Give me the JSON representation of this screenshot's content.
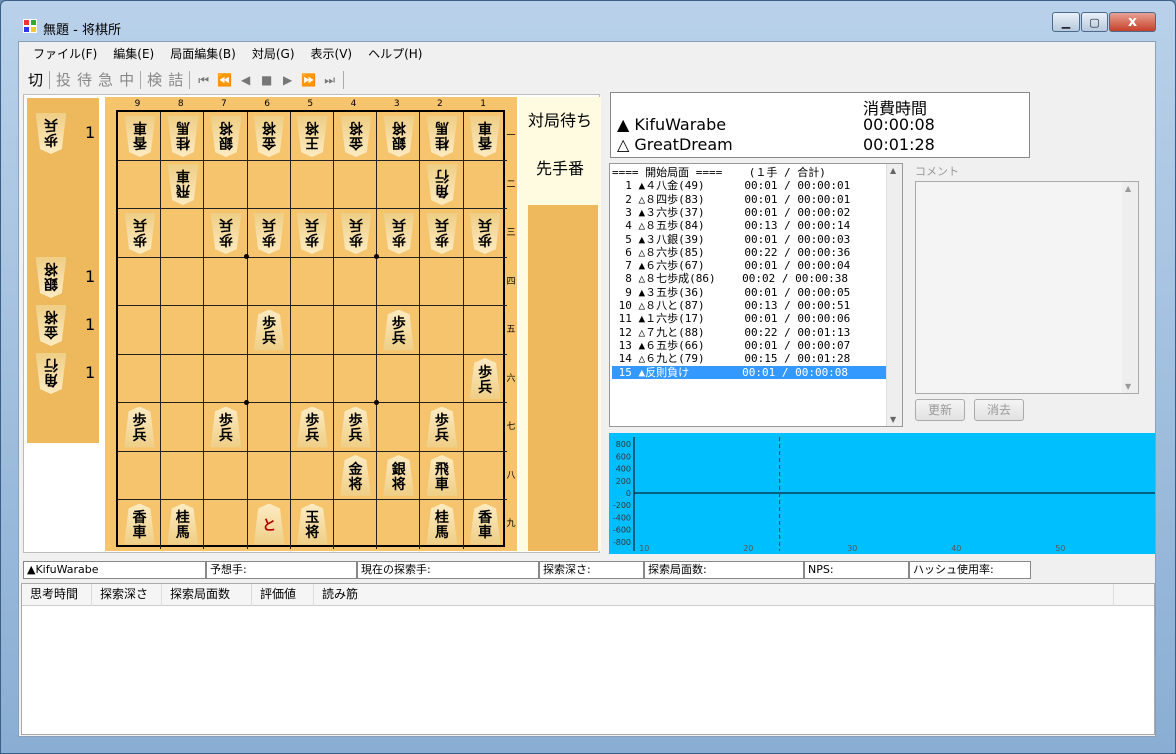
{
  "window": {
    "title": "無題 - 将棋所",
    "min_icon": "minimize-icon",
    "max_icon": "maximize-icon",
    "close_icon": "close-icon",
    "close_glyph": "x",
    "app_icon": "app-icon"
  },
  "menu": [
    {
      "label": "ファイル(F)"
    },
    {
      "label": "編集(E)"
    },
    {
      "label": "局面編集(B)"
    },
    {
      "label": "対局(G)"
    },
    {
      "label": "表示(V)"
    },
    {
      "label": "ヘルプ(H)"
    }
  ],
  "toolbar": {
    "switch_label": "切",
    "resign_label": "投",
    "wait_label": "待",
    "hurry_label": "急",
    "stop_label": "中",
    "review_label": "検",
    "tsume_label": "詰",
    "nav_icons": [
      "first-icon",
      "rewind-icon",
      "back-icon",
      "stop-icon",
      "play-icon",
      "forward-icon",
      "last-icon"
    ]
  },
  "board": {
    "files": [
      "9",
      "8",
      "7",
      "6",
      "5",
      "4",
      "3",
      "2",
      "1"
    ],
    "ranks": [
      "一",
      "二",
      "三",
      "四",
      "五",
      "六",
      "七",
      "八",
      "九"
    ],
    "pieces": [
      {
        "c": 0,
        "r": 0,
        "t": "香車",
        "g": true
      },
      {
        "c": 1,
        "r": 0,
        "t": "桂馬",
        "g": true
      },
      {
        "c": 2,
        "r": 0,
        "t": "銀将",
        "g": true
      },
      {
        "c": 3,
        "r": 0,
        "t": "金将",
        "g": true
      },
      {
        "c": 4,
        "r": 0,
        "t": "王将",
        "g": true
      },
      {
        "c": 5,
        "r": 0,
        "t": "金将",
        "g": true
      },
      {
        "c": 6,
        "r": 0,
        "t": "銀将",
        "g": true
      },
      {
        "c": 7,
        "r": 0,
        "t": "桂馬",
        "g": true
      },
      {
        "c": 8,
        "r": 0,
        "t": "香車",
        "g": true
      },
      {
        "c": 1,
        "r": 1,
        "t": "飛車",
        "g": true
      },
      {
        "c": 7,
        "r": 1,
        "t": "角行",
        "g": true
      },
      {
        "c": 0,
        "r": 2,
        "t": "歩兵",
        "g": true
      },
      {
        "c": 2,
        "r": 2,
        "t": "歩兵",
        "g": true
      },
      {
        "c": 3,
        "r": 2,
        "t": "歩兵",
        "g": true
      },
      {
        "c": 4,
        "r": 2,
        "t": "歩兵",
        "g": true
      },
      {
        "c": 5,
        "r": 2,
        "t": "歩兵",
        "g": true
      },
      {
        "c": 6,
        "r": 2,
        "t": "歩兵",
        "g": true
      },
      {
        "c": 7,
        "r": 2,
        "t": "歩兵",
        "g": true
      },
      {
        "c": 8,
        "r": 2,
        "t": "歩兵",
        "g": true
      },
      {
        "c": 3,
        "r": 4,
        "t": "歩兵",
        "g": false
      },
      {
        "c": 6,
        "r": 4,
        "t": "歩兵",
        "g": false
      },
      {
        "c": 8,
        "r": 5,
        "t": "歩兵",
        "g": false
      },
      {
        "c": 0,
        "r": 6,
        "t": "歩兵",
        "g": false
      },
      {
        "c": 2,
        "r": 6,
        "t": "歩兵",
        "g": false
      },
      {
        "c": 4,
        "r": 6,
        "t": "歩兵",
        "g": false
      },
      {
        "c": 5,
        "r": 6,
        "t": "歩兵",
        "g": false
      },
      {
        "c": 7,
        "r": 6,
        "t": "歩兵",
        "g": false
      },
      {
        "c": 5,
        "r": 7,
        "t": "金将",
        "g": false
      },
      {
        "c": 6,
        "r": 7,
        "t": "銀将",
        "g": false
      },
      {
        "c": 7,
        "r": 7,
        "t": "飛車",
        "g": false
      },
      {
        "c": 0,
        "r": 8,
        "t": "香車",
        "g": false
      },
      {
        "c": 1,
        "r": 8,
        "t": "桂馬",
        "g": false
      },
      {
        "c": 3,
        "r": 8,
        "t": "と",
        "g": false,
        "p": true
      },
      {
        "c": 4,
        "r": 8,
        "t": "玉将",
        "g": false
      },
      {
        "c": 7,
        "r": 8,
        "t": "桂馬",
        "g": false
      },
      {
        "c": 8,
        "r": 8,
        "t": "香車",
        "g": false
      }
    ],
    "gote_hand": [
      {
        "t": "歩兵",
        "n": "1"
      },
      {
        "t": "銀将",
        "n": "1"
      },
      {
        "t": "金将",
        "n": "1"
      },
      {
        "t": "角行",
        "n": "1"
      }
    ]
  },
  "side": {
    "status": "対局待ち",
    "turn": "先手番"
  },
  "time": {
    "header": "消費時間",
    "sente_name": "▲ KifuWarabe",
    "sente_time": "00:00:08",
    "gote_name": "△ GreatDream",
    "gote_time": "00:01:28"
  },
  "kifu": {
    "rows": [
      "==== 開始局面 ====    (１手 / 合計)",
      "  1 ▲４八金(49)      00:01 / 00:00:01",
      "  2 △８四歩(83)      00:01 / 00:00:01",
      "  3 ▲３六歩(37)      00:01 / 00:00:02",
      "  4 △８五歩(84)      00:13 / 00:00:14",
      "  5 ▲３八銀(39)      00:01 / 00:00:03",
      "  6 △８六歩(85)      00:22 / 00:00:36",
      "  7 ▲６六歩(67)      00:01 / 00:00:04",
      "  8 △８七歩成(86)    00:02 / 00:00:38",
      "  9 ▲３五歩(36)      00:01 / 00:00:05",
      " 10 △８八と(87)      00:13 / 00:00:51",
      " 11 ▲１六歩(17)      00:01 / 00:00:06",
      " 12 △７九と(88)      00:22 / 00:01:13",
      " 13 ▲６五歩(66)      00:01 / 00:00:07",
      " 14 △６九と(79)      00:15 / 00:01:28",
      " 15 ▲反則負け        00:01 / 00:00:08"
    ],
    "selected_index": 15
  },
  "comment": {
    "label": "コメント",
    "update_label": "更新",
    "clear_label": "消去"
  },
  "graph": {
    "bg": "#00bfff",
    "y_ticks": [
      "800",
      "600",
      "400",
      "200",
      "0",
      "-200",
      "-400",
      "-600",
      "-800"
    ],
    "x_ticks": [
      "10",
      "20",
      "30",
      "40",
      "50"
    ]
  },
  "status": {
    "player": "▲KifuWarabe",
    "predict": "予想手:",
    "current": "現在の探索手:",
    "depth": "探索深さ:",
    "nodes": "探索局面数:",
    "nps": "NPS:",
    "hash": "ハッシュ使用率:"
  },
  "pv": {
    "cols": [
      "思考時間",
      "探索深さ",
      "探索局面数",
      "評価値",
      "読み筋"
    ]
  }
}
